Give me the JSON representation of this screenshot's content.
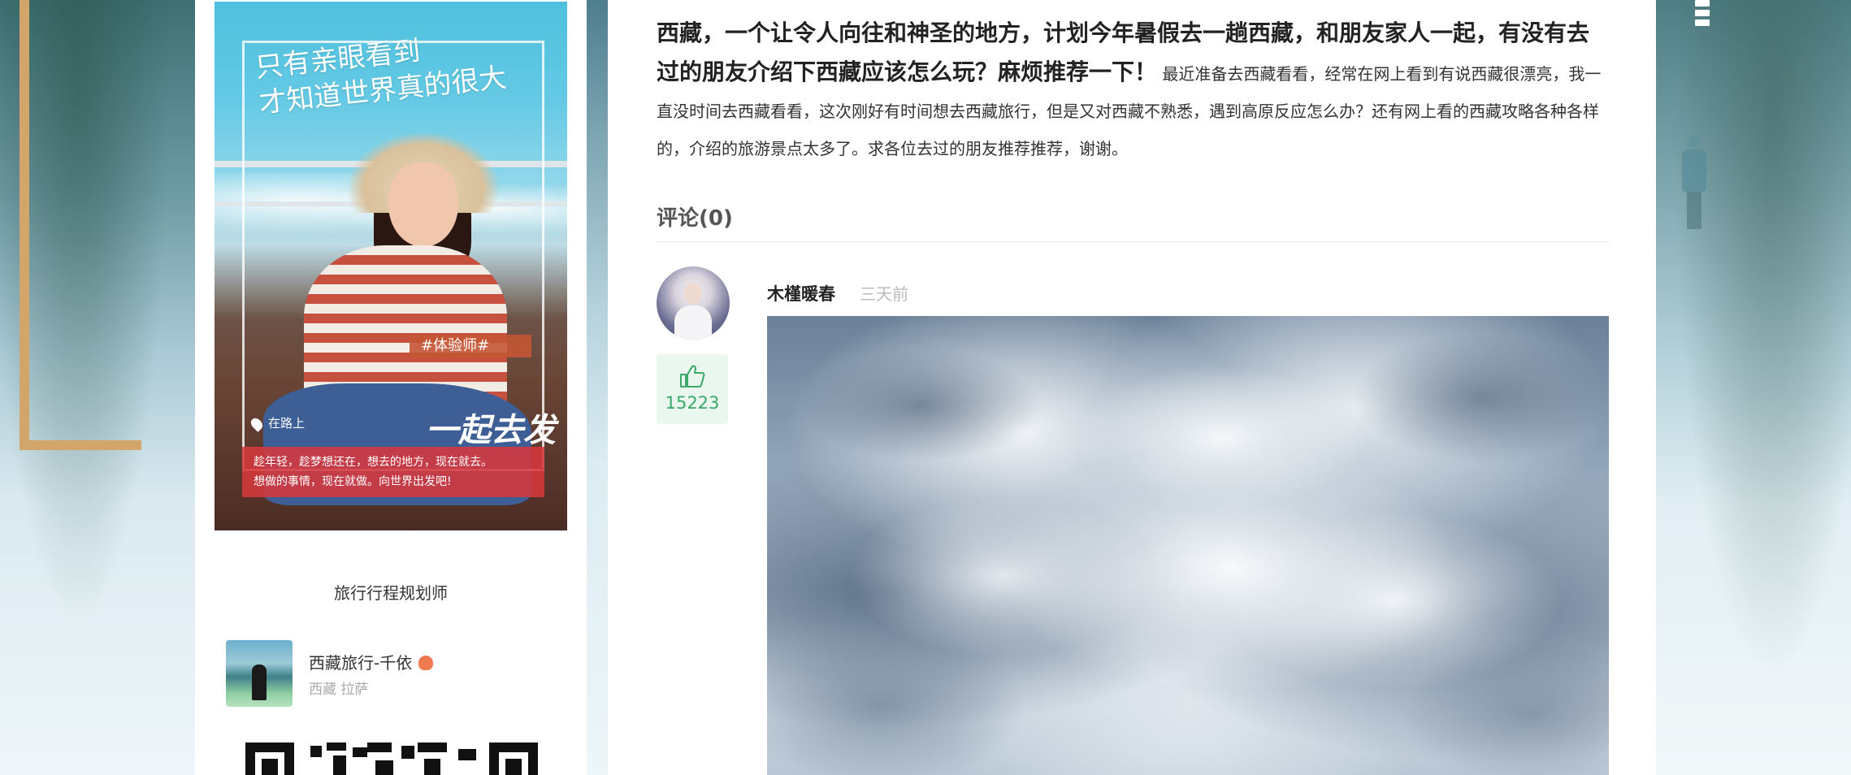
{
  "background": {
    "accent_color": "#d2a56a"
  },
  "poster": {
    "title_line1": "只有亲眼看到",
    "title_line2": "才知道世界真的很大",
    "banner": "#体验师#",
    "location": "在路上",
    "slogan": "一起去发",
    "bottom_line1": "趁年轻，趁梦想还在，想去的地方，现在就去。",
    "bottom_line2": "想做的事情，现在就做。向世界出发吧!"
  },
  "planner": {
    "section_title": "旅行行程规划师",
    "name": "西藏旅行-千依",
    "location": "西藏 拉萨"
  },
  "question": {
    "title": "西藏，一个让令人向往和神圣的地方，计划今年暑假去一趟西藏，和朋友家人一起，有没有去过的朋友介绍下西藏应该怎么玩？麻烦推荐一下！",
    "body": "最近准备去西藏看看，经常在网上看到有说西藏很漂亮，我一直没时间去西藏看看，这次刚好有时间想去西藏旅行，但是又对西藏不熟悉，遇到高原反应怎么办？还有网上看的西藏攻略各种各样的，介绍的旅游景点太多了。求各位去过的朋友推荐推荐，谢谢。"
  },
  "comments": {
    "header": "评论(0)",
    "items": [
      {
        "user": "木槿暖春",
        "time": "三天前",
        "likes": "15223",
        "like_color": "#3aa868"
      }
    ]
  }
}
